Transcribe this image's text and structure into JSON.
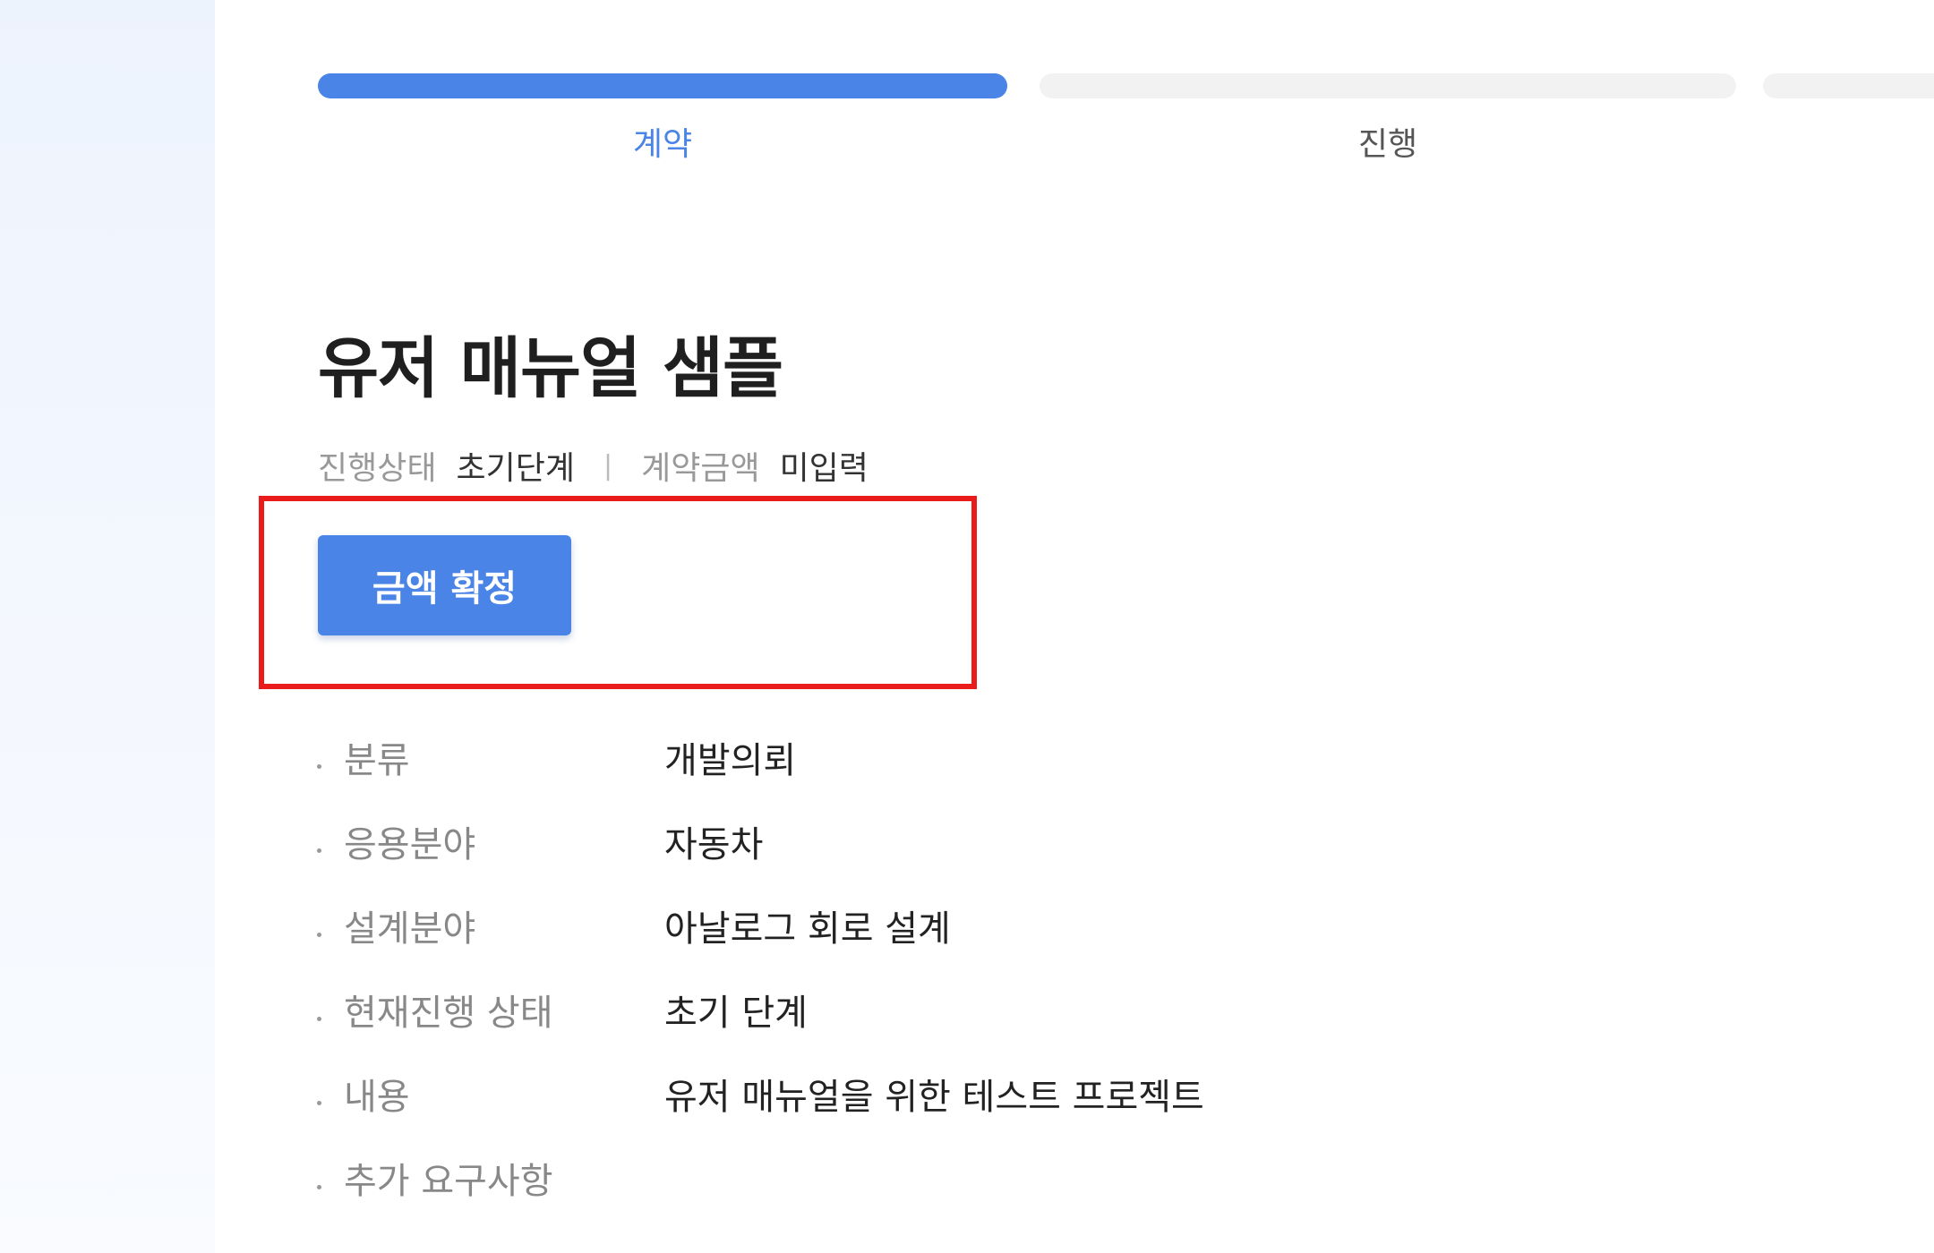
{
  "stepper": {
    "steps": [
      {
        "label": "계약",
        "active": true
      },
      {
        "label": "진행",
        "active": false
      },
      {
        "label": "",
        "active": false
      }
    ]
  },
  "project": {
    "title": "유저 매뉴얼 샘플",
    "meta": {
      "status_key": "진행상태",
      "status_value": "초기단계",
      "separator": "|",
      "amount_key": "계약금액",
      "amount_value": "미입력"
    },
    "confirm_button": "금액 확정"
  },
  "details": [
    {
      "label": "분류",
      "value": "개발의뢰"
    },
    {
      "label": "응용분야",
      "value": "자동차"
    },
    {
      "label": "설계분야",
      "value": "아날로그 회로 설계"
    },
    {
      "label": "현재진행 상태",
      "value": "초기 단계"
    },
    {
      "label": "내용",
      "value": "유저 매뉴얼을 위한 테스트 프로젝트"
    },
    {
      "label": "추가 요구사항",
      "value": ""
    }
  ],
  "colors": {
    "accent": "#4a84e6",
    "highlight": "#ea1b1b",
    "inactive_bar": "#f2f2f2",
    "sidebar_tint": "#edf3fd"
  }
}
